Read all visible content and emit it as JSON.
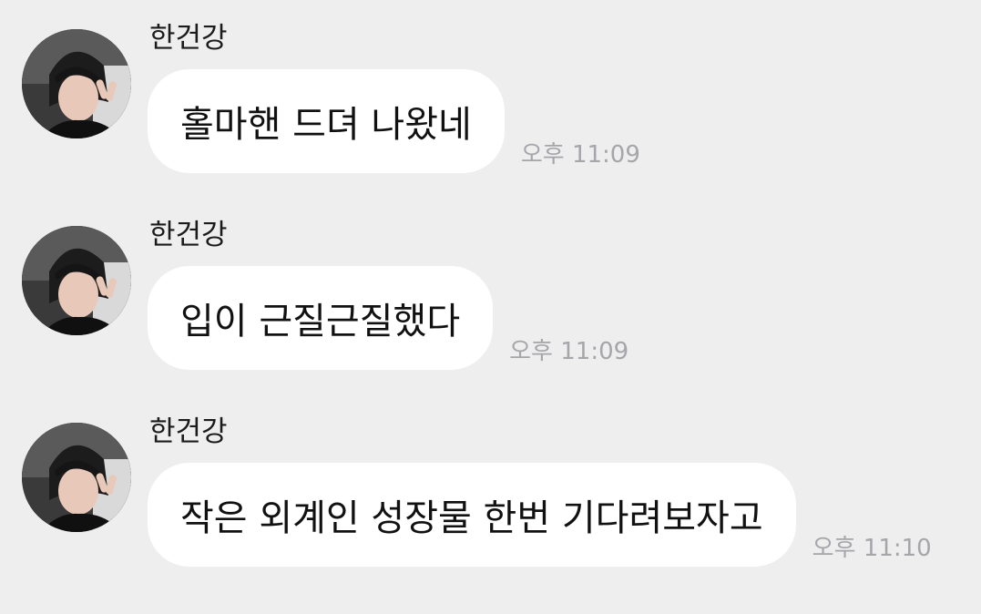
{
  "messages": [
    {
      "sender": "한건강",
      "text": "홀마핸 드뎌 나왔네",
      "time": "오후 11:09"
    },
    {
      "sender": "한건강",
      "text": "입이 근질근질했다",
      "time": "오후 11:09"
    },
    {
      "sender": "한건강",
      "text": "작은 외계인 성장물 한번 기다려보자고",
      "time": "오후 11:10"
    }
  ],
  "colors": {
    "background": "#eeeeef",
    "bubble": "#ffffff",
    "text": "#111111",
    "timestamp": "#a6a6aa"
  }
}
